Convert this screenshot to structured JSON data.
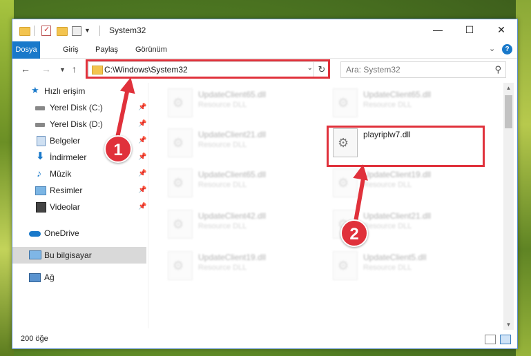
{
  "window": {
    "title": "System32",
    "controls": {
      "minimize": "—",
      "maximize": "☐",
      "close": "✕"
    }
  },
  "ribbon": {
    "tabs": [
      "Dosya",
      "Giriş",
      "Paylaş",
      "Görünüm"
    ],
    "help": "?"
  },
  "address": {
    "path": "C:\\Windows\\System32"
  },
  "search": {
    "placeholder": "Ara: System32"
  },
  "sidebar": {
    "items": [
      {
        "label": "Hızlı erişim",
        "icon": "star-icon"
      },
      {
        "label": "Yerel Disk (C:)",
        "icon": "drive-icon"
      },
      {
        "label": "Yerel Disk (D:)",
        "icon": "drive-icon"
      },
      {
        "label": "Belgeler",
        "icon": "documents-icon"
      },
      {
        "label": "İndirmeler",
        "icon": "downloads-icon"
      },
      {
        "label": "Müzik",
        "icon": "music-icon"
      },
      {
        "label": "Resimler",
        "icon": "pictures-icon"
      },
      {
        "label": "Videolar",
        "icon": "videos-icon"
      },
      {
        "label": "OneDrive",
        "icon": "onedrive-icon"
      },
      {
        "label": "Bu bilgisayar",
        "icon": "computer-icon"
      },
      {
        "label": "Ağ",
        "icon": "network-icon"
      }
    ]
  },
  "files": [
    {
      "name": "UpdateClient65.dll",
      "type": "Resource DLL"
    },
    {
      "name": "UpdateClient65.dll",
      "type": "Resource DLL"
    },
    {
      "name": "UpdateClient21.dll",
      "type": "Resource DLL"
    },
    {
      "name": "playriplw7.dll",
      "type": ""
    },
    {
      "name": "UpdateClient65.dll",
      "type": "Resource DLL"
    },
    {
      "name": "UpdateClient19.dll",
      "type": "Resource DLL"
    },
    {
      "name": "UpdateClient42.dll",
      "type": "Resource DLL"
    },
    {
      "name": "UpdateClient21.dll",
      "type": "Resource DLL"
    },
    {
      "name": "UpdateClient19.dll",
      "type": "Resource DLL"
    },
    {
      "name": "UpdateClient5.dll",
      "type": "Resource DLL"
    }
  ],
  "status": {
    "count": "200 öğe"
  },
  "annotations": {
    "step1": "1",
    "step2": "2",
    "highlight_color": "#e0313b"
  }
}
